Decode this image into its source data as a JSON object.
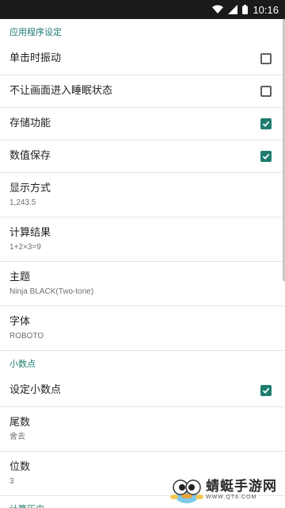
{
  "status_bar": {
    "time": "10:16"
  },
  "sections": {
    "app_settings": {
      "header": "应用程序设定"
    },
    "decimal": {
      "header": "小数点"
    },
    "history": {
      "header": "计算历史"
    }
  },
  "items": {
    "vibrate": {
      "title": "单击时振动",
      "checked": false
    },
    "no_sleep": {
      "title": "不让画面进入睡眠状态",
      "checked": false
    },
    "storage": {
      "title": "存储功能",
      "checked": true
    },
    "value_save": {
      "title": "数值保存",
      "checked": true
    },
    "display_mode": {
      "title": "显示方式",
      "value": "1,243.5"
    },
    "calc_result": {
      "title": "计算结果",
      "value": "1+2×3=9"
    },
    "theme": {
      "title": "主题",
      "value": "Ninja BLACK(Two-tone)"
    },
    "font": {
      "title": "字体",
      "value": "ROBOTO"
    },
    "set_decimal": {
      "title": "设定小数点",
      "checked": true
    },
    "tail": {
      "title": "尾数",
      "value": "舍去"
    },
    "digits": {
      "title": "位数",
      "value": "3"
    }
  },
  "watermark": {
    "text": "蜻蜓手游网",
    "url": "WWW.QT6.COM"
  },
  "colors": {
    "accent": "#1e7d6f",
    "status_bar": "#1a1a1a",
    "divider": "#e4e4e4"
  }
}
